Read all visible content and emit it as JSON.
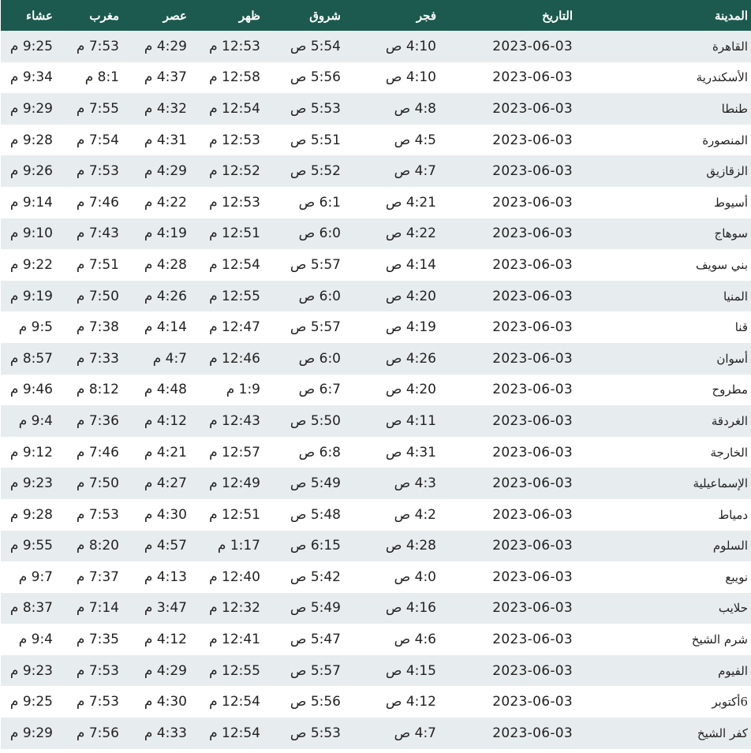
{
  "headers": [
    "المدينة",
    "التاريخ",
    "فجر",
    "شروق",
    "ظهر",
    "عصر",
    "مغرب",
    "عشاء"
  ],
  "rows": [
    {
      "city": "القاهرة",
      "date": "2023-06-03",
      "fajr": "4:10 ص",
      "sunrise": "5:54 ص",
      "dhuhr": "12:53 م",
      "asr": "4:29 م",
      "maghrib": "7:53 م",
      "isha": "9:25 م"
    },
    {
      "city": "الأسكندرية",
      "date": "2023-06-03",
      "fajr": "4:10 ص",
      "sunrise": "5:56 ص",
      "dhuhr": "12:58 م",
      "asr": "4:37 م",
      "maghrib": "8:1 م",
      "isha": "9:34 م"
    },
    {
      "city": "طنطا",
      "date": "2023-06-03",
      "fajr": "4:8 ص",
      "sunrise": "5:53 ص",
      "dhuhr": "12:54 م",
      "asr": "4:32 م",
      "maghrib": "7:55 م",
      "isha": "9:29 م"
    },
    {
      "city": "المنصورة",
      "date": "2023-06-03",
      "fajr": "4:5 ص",
      "sunrise": "5:51 ص",
      "dhuhr": "12:53 م",
      "asr": "4:31 م",
      "maghrib": "7:54 م",
      "isha": "9:28 م"
    },
    {
      "city": "الزقازيق",
      "date": "2023-06-03",
      "fajr": "4:7 ص",
      "sunrise": "5:52 ص",
      "dhuhr": "12:52 م",
      "asr": "4:29 م",
      "maghrib": "7:53 م",
      "isha": "9:26 م"
    },
    {
      "city": "أسيوط",
      "date": "2023-06-03",
      "fajr": "4:21 ص",
      "sunrise": "6:1 ص",
      "dhuhr": "12:53 م",
      "asr": "4:22 م",
      "maghrib": "7:46 م",
      "isha": "9:14 م"
    },
    {
      "city": "سوهاج",
      "date": "2023-06-03",
      "fajr": "4:22 ص",
      "sunrise": "6:0 ص",
      "dhuhr": "12:51 م",
      "asr": "4:19 م",
      "maghrib": "7:43 م",
      "isha": "9:10 م"
    },
    {
      "city": "بني سويف",
      "date": "2023-06-03",
      "fajr": "4:14 ص",
      "sunrise": "5:57 ص",
      "dhuhr": "12:54 م",
      "asr": "4:28 م",
      "maghrib": "7:51 م",
      "isha": "9:22 م"
    },
    {
      "city": "المنيا",
      "date": "2023-06-03",
      "fajr": "4:20 ص",
      "sunrise": "6:0 ص",
      "dhuhr": "12:55 م",
      "asr": "4:26 م",
      "maghrib": "7:50 م",
      "isha": "9:19 م"
    },
    {
      "city": "قنا",
      "date": "2023-06-03",
      "fajr": "4:19 ص",
      "sunrise": "5:57 ص",
      "dhuhr": "12:47 م",
      "asr": "4:14 م",
      "maghrib": "7:38 م",
      "isha": "9:5 م"
    },
    {
      "city": "أسوان",
      "date": "2023-06-03",
      "fajr": "4:26 ص",
      "sunrise": "6:0 ص",
      "dhuhr": "12:46 م",
      "asr": "4:7 م",
      "maghrib": "7:33 م",
      "isha": "8:57 م"
    },
    {
      "city": "مطروح",
      "date": "2023-06-03",
      "fajr": "4:20 ص",
      "sunrise": "6:7 ص",
      "dhuhr": "1:9 م",
      "asr": "4:48 م",
      "maghrib": "8:12 م",
      "isha": "9:46 م"
    },
    {
      "city": "الغردقة",
      "date": "2023-06-03",
      "fajr": "4:11 ص",
      "sunrise": "5:50 ص",
      "dhuhr": "12:43 م",
      "asr": "4:12 م",
      "maghrib": "7:36 م",
      "isha": "9:4 م"
    },
    {
      "city": "الخارجة",
      "date": "2023-06-03",
      "fajr": "4:31 ص",
      "sunrise": "6:8 ص",
      "dhuhr": "12:57 م",
      "asr": "4:21 م",
      "maghrib": "7:46 م",
      "isha": "9:12 م"
    },
    {
      "city": "الإسماعيلية",
      "date": "2023-06-03",
      "fajr": "4:3 ص",
      "sunrise": "5:49 ص",
      "dhuhr": "12:49 م",
      "asr": "4:27 م",
      "maghrib": "7:50 م",
      "isha": "9:23 م"
    },
    {
      "city": "دمياط",
      "date": "2023-06-03",
      "fajr": "4:2 ص",
      "sunrise": "5:48 ص",
      "dhuhr": "12:51 م",
      "asr": "4:30 م",
      "maghrib": "7:53 م",
      "isha": "9:28 م"
    },
    {
      "city": "السلوم",
      "date": "2023-06-03",
      "fajr": "4:28 ص",
      "sunrise": "6:15 ص",
      "dhuhr": "1:17 م",
      "asr": "4:57 م",
      "maghrib": "8:20 م",
      "isha": "9:55 م"
    },
    {
      "city": "نويبع",
      "date": "2023-06-03",
      "fajr": "4:0 ص",
      "sunrise": "5:42 ص",
      "dhuhr": "12:40 م",
      "asr": "4:13 م",
      "maghrib": "7:37 م",
      "isha": "9:7 م"
    },
    {
      "city": "حلايب",
      "date": "2023-06-03",
      "fajr": "4:16 ص",
      "sunrise": "5:49 ص",
      "dhuhr": "12:32 م",
      "asr": "3:47 م",
      "maghrib": "7:14 م",
      "isha": "8:37 م"
    },
    {
      "city": "شرم الشيخ",
      "date": "2023-06-03",
      "fajr": "4:6 ص",
      "sunrise": "5:47 ص",
      "dhuhr": "12:41 م",
      "asr": "4:12 م",
      "maghrib": "7:35 م",
      "isha": "9:4 م"
    },
    {
      "city": "الفيوم",
      "date": "2023-06-03",
      "fajr": "4:15 ص",
      "sunrise": "5:57 ص",
      "dhuhr": "12:55 م",
      "asr": "4:29 م",
      "maghrib": "7:53 م",
      "isha": "9:23 م"
    },
    {
      "city": "6أكتوبر",
      "date": "2023-06-03",
      "fajr": "4:12 ص",
      "sunrise": "5:56 ص",
      "dhuhr": "12:54 م",
      "asr": "4:30 م",
      "maghrib": "7:53 م",
      "isha": "9:25 م"
    },
    {
      "city": "كفر الشيخ",
      "date": "2023-06-03",
      "fajr": "4:7 ص",
      "sunrise": "5:53 ص",
      "dhuhr": "12:54 م",
      "asr": "4:33 م",
      "maghrib": "7:56 م",
      "isha": "9:29 م"
    }
  ],
  "colors": {
    "header_bg": "#1c5a4f",
    "header_text": "#ffffff",
    "row_alt_bg": "#e7ecee",
    "row_bg": "#ffffff",
    "text": "#222222"
  }
}
